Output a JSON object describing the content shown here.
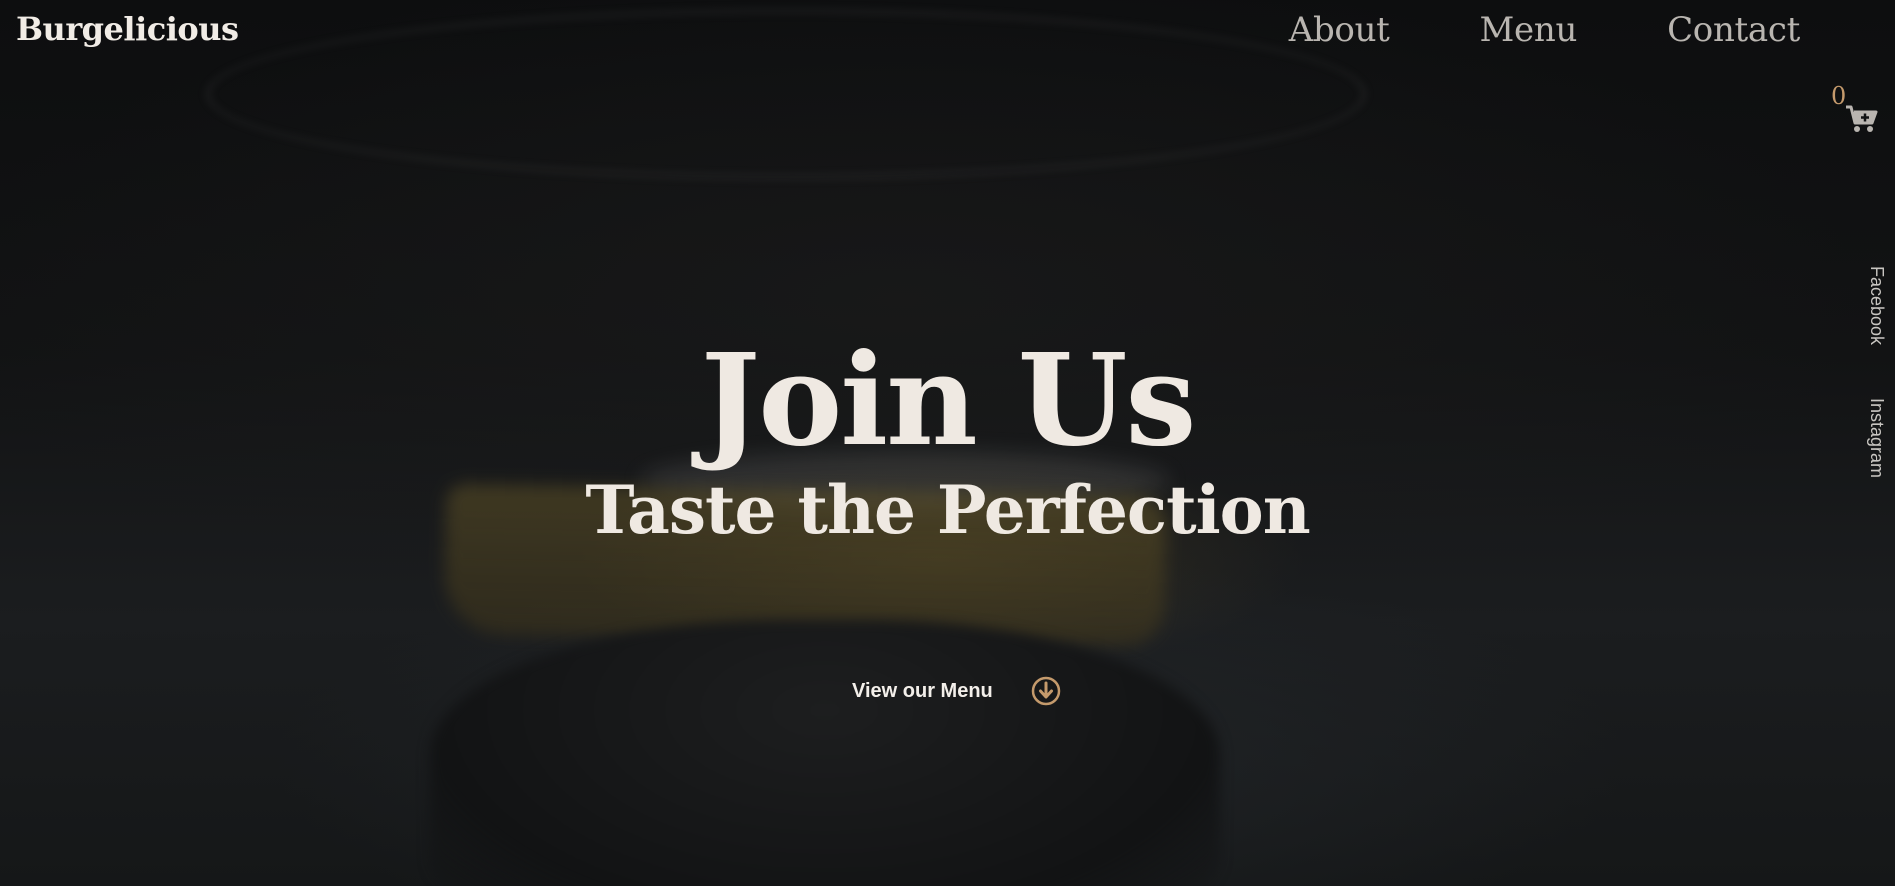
{
  "header": {
    "brand": "Burgelicious",
    "nav": [
      {
        "label": "About"
      },
      {
        "label": "Menu"
      },
      {
        "label": "Contact"
      }
    ]
  },
  "cart": {
    "count": "0",
    "icon": "cart-plus-icon"
  },
  "social": {
    "facebook": "Facebook",
    "instagram": "Instagram"
  },
  "hero": {
    "title": "Join Us",
    "subtitle": "Taste the Perfection",
    "cta_label": "View our Menu",
    "cta_icon": "arrow-down-circle-icon"
  },
  "colors": {
    "accent": "#c49a6c",
    "text_light": "#efe9e2",
    "nav_text": "#b9b5b0",
    "background": "#0b0c0d"
  }
}
